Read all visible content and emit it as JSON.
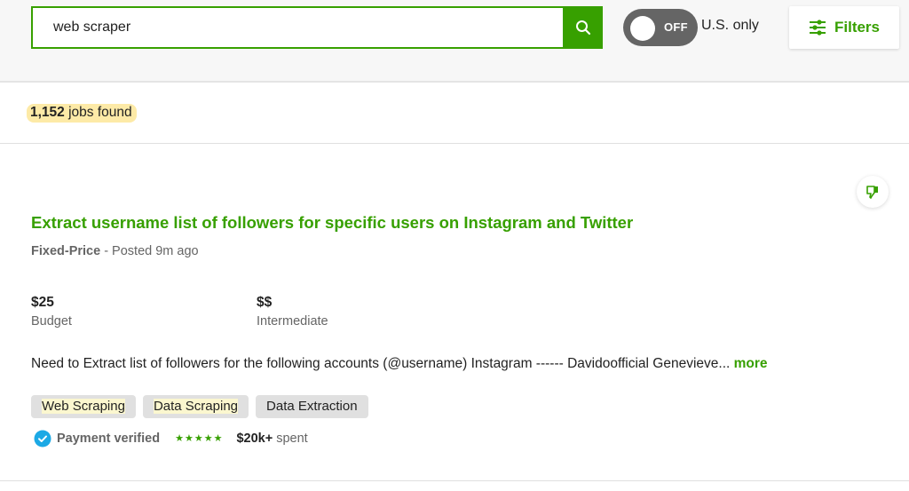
{
  "search": {
    "value": "web scraper",
    "button_icon": "search-icon"
  },
  "toggle": {
    "state": "OFF",
    "label": "U.S. only"
  },
  "filters": {
    "label": "Filters",
    "icon": "sliders-icon"
  },
  "results": {
    "count": "1,152",
    "suffix": " jobs found"
  },
  "job": {
    "title": "Extract username list of followers for specific users on Instagram and Twitter",
    "type": "Fixed-Price",
    "posted": " - Posted 9m ago",
    "budget_value": "$25",
    "budget_label": "Budget",
    "level_value": "$$",
    "level_label": "Intermediate",
    "description": "Need to Extract list of followers for the following accounts (@username) Instagram ------ Davidoofficial Genevieve...",
    "more_label": " more",
    "tags": [
      "Web Scraping",
      "Data Scraping",
      "Data Extraction"
    ],
    "payment_verified": "Payment verified",
    "rating_stars": 5,
    "spent_amount": "$20k+",
    "spent_label": " spent",
    "dislike_icon": "thumbs-down-icon"
  },
  "colors": {
    "brand_green": "#37a000",
    "toggle_gray": "#656565",
    "highlight_yellow": "#fdeaa7",
    "verified_blue": "#1ca9e5",
    "tag_bg": "#e0e0e0"
  }
}
